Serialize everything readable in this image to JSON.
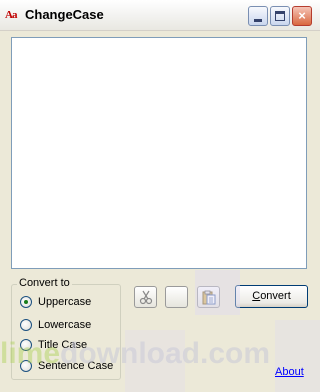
{
  "window": {
    "icon_text": "Aa",
    "title": "ChangeCase"
  },
  "editor": {
    "value": ""
  },
  "convert_group": {
    "label": "Convert to",
    "options": [
      {
        "label": "Uppercase",
        "selected": true
      },
      {
        "label": "Lowercase",
        "selected": false
      },
      {
        "label": "Title Case",
        "selected": false
      },
      {
        "label": "Sentence Case",
        "selected": false
      }
    ]
  },
  "toolbar": {
    "cut_icon": "scissors-icon",
    "copy_icon": "copy-icon",
    "paste_icon": "clipboard-icon",
    "convert_label_underlined": "C",
    "convert_label_rest": "onvert"
  },
  "footer": {
    "about_label": "About"
  },
  "watermark": {
    "part_a": "lime",
    "part_b": "download.com"
  }
}
